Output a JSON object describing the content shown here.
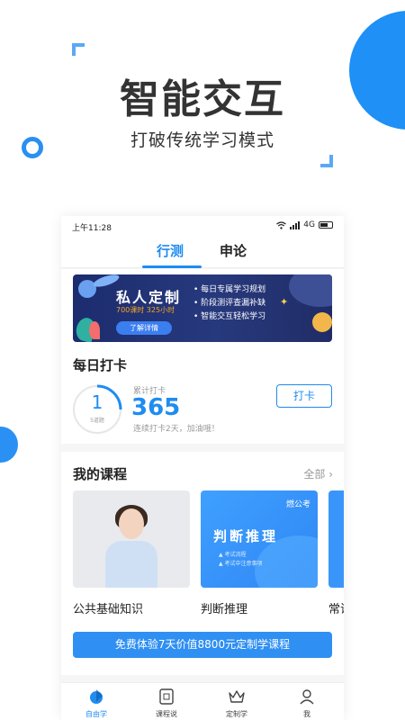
{
  "hero": {
    "title": "智能交互",
    "subtitle": "打破传统学习模式"
  },
  "status_bar": {
    "time": "上午11:28",
    "network": "4G"
  },
  "top_tabs": [
    {
      "label": "行测",
      "active": true
    },
    {
      "label": "申论",
      "active": false
    }
  ],
  "banner": {
    "title": "私人定制",
    "hours": "700课时  325小时",
    "button": "了解详情",
    "features": [
      "• 每日专属学习规划",
      "• 阶段测评查漏补缺",
      "• 智能交互轻松学习"
    ]
  },
  "daily_checkin": {
    "title": "每日打卡",
    "ring_value": "1",
    "ring_caption": "5道题",
    "accumulated_label": "累计打卡",
    "accumulated_value": "365",
    "tip": "连续打卡2天，加油哦！",
    "button": "打卡"
  },
  "my_courses": {
    "title": "我的课程",
    "all_link": "全部  ›",
    "items": [
      {
        "label": "公共基础知识"
      },
      {
        "label": "判断推理",
        "tag": "燃公考",
        "card_title": "判断推理",
        "notes": [
          "▲ 考试流程",
          "▲ 考试中注意事项"
        ]
      },
      {
        "label": "常识"
      }
    ]
  },
  "promo": {
    "button": "免费体验7天价值8800元定制学课程"
  },
  "bottom_nav": [
    {
      "label": "自由学",
      "icon": "free-study-icon",
      "active": true
    },
    {
      "label": "课程说",
      "icon": "course-talk-icon",
      "active": false
    },
    {
      "label": "定制学",
      "icon": "crown-icon",
      "active": false
    },
    {
      "label": "我",
      "icon": "person-icon",
      "active": false
    }
  ],
  "colors": {
    "accent": "#1f8cf0",
    "banner_bg": "#1c2c6e",
    "highlight": "#f5a623"
  }
}
